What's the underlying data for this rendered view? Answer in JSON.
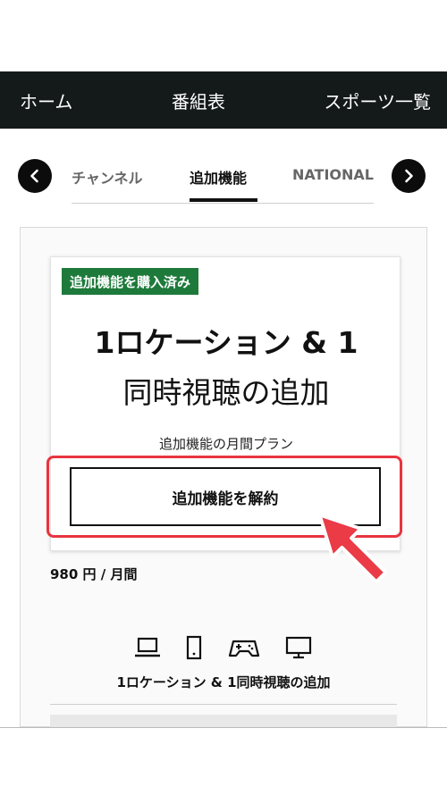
{
  "nav": {
    "items": [
      {
        "label": "ホーム"
      },
      {
        "label": "番組表"
      },
      {
        "label": "スポーツ一覧"
      }
    ]
  },
  "tabs": {
    "items": [
      {
        "label": "チャンネル",
        "active": false
      },
      {
        "label": "追加機能",
        "active": true
      },
      {
        "label": "NATIONAL LEAGUE",
        "active": false
      }
    ],
    "prev_icon": "chevron-left-icon",
    "next_icon": "chevron-right-icon"
  },
  "card": {
    "badge": "追加機能を購入済み",
    "title_line1": "1ロケーション & 1",
    "title_line2": "同時視聴の追加",
    "subtitle": "追加機能の月間プラン",
    "cancel_label": "追加機能を解約",
    "price": "980 円 / 月間",
    "devices": [
      "laptop-icon",
      "phone-icon",
      "gamepad-icon",
      "monitor-icon"
    ],
    "features_label": "1ロケーション & 1同時視聴の追加"
  },
  "colors": {
    "nav_bg": "#14191a",
    "badge_bg": "#1e7a3b",
    "highlight": "#e8343f"
  }
}
